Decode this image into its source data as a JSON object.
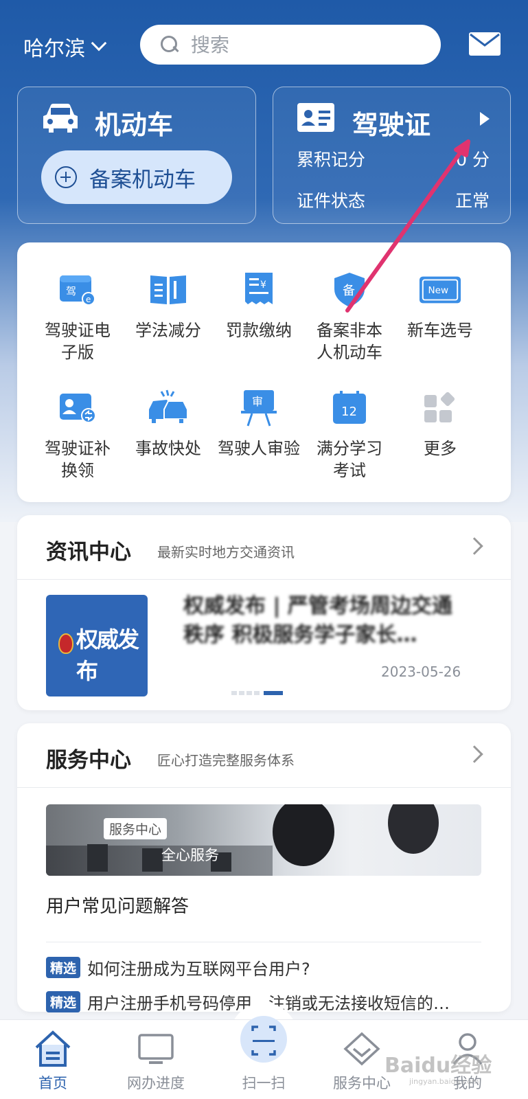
{
  "header": {
    "city": "哈尔滨",
    "search_placeholder": "搜索"
  },
  "vehicle_card": {
    "title": "机动车",
    "add_button_label": "备案机动车"
  },
  "license_card": {
    "title": "驾驶证",
    "points_label": "累积记分",
    "points_value": "0",
    "points_unit": "分",
    "status_label": "证件状态",
    "status_value": "正常"
  },
  "services_grid": [
    {
      "line1": "驾驶证电",
      "line2": "子版",
      "icon": "e-license-icon"
    },
    {
      "line1": "学法减分",
      "line2": "",
      "icon": "book-icon"
    },
    {
      "line1": "罚款缴纳",
      "line2": "",
      "icon": "fine-receipt-icon"
    },
    {
      "line1": "备案非本",
      "line2": "人机动车",
      "icon": "shield-register-icon"
    },
    {
      "line1": "新车选号",
      "line2": "",
      "icon": "new-plate-icon"
    },
    {
      "line1": "驾驶证补",
      "line2": "换领",
      "icon": "license-renew-icon"
    },
    {
      "line1": "事故快处",
      "line2": "",
      "icon": "accident-icon"
    },
    {
      "line1": "驾驶人审验",
      "line2": "",
      "icon": "driver-review-icon"
    },
    {
      "line1": "满分学习",
      "line2": "考试",
      "icon": "calendar-12-icon"
    },
    {
      "line1": "更多",
      "line2": "",
      "icon": "more-grid-icon"
    }
  ],
  "news": {
    "title": "资讯中心",
    "subtitle": "最新实时地方交通资讯",
    "thumb_text": "权威发布",
    "headline": "权威发布 | 严管考场周边交通秩序 积极服务学子家长…",
    "date": "2023-05-26"
  },
  "service_center": {
    "title": "服务中心",
    "subtitle": "匠心打造完整服务体系",
    "banner_tag": "服务中心",
    "banner_slogan": "全心服务",
    "faq_title": "用户常见问题解答",
    "faq": [
      {
        "badge": "精选",
        "question": "如何注册成为互联网平台用户?"
      },
      {
        "badge": "精选",
        "question": "用户注册手机号码停用、注销或无法接收短信的…"
      }
    ]
  },
  "bottom_nav": [
    {
      "label": "首页",
      "icon": "home-icon",
      "active": true
    },
    {
      "label": "网办进度",
      "icon": "monitor-icon",
      "active": false
    },
    {
      "label": "扫一扫",
      "icon": "scan-icon",
      "active": false
    },
    {
      "label": "服务中心",
      "icon": "diamond-service-icon",
      "active": false
    },
    {
      "label": "我的",
      "icon": "user-icon",
      "active": false
    }
  ],
  "watermark": {
    "text": "Baidu经验",
    "sub": "jingyan.baidu.com"
  },
  "colors": {
    "primary": "#2d63ae",
    "hero": "#1f5aa8",
    "annotation": "#e0336f"
  }
}
